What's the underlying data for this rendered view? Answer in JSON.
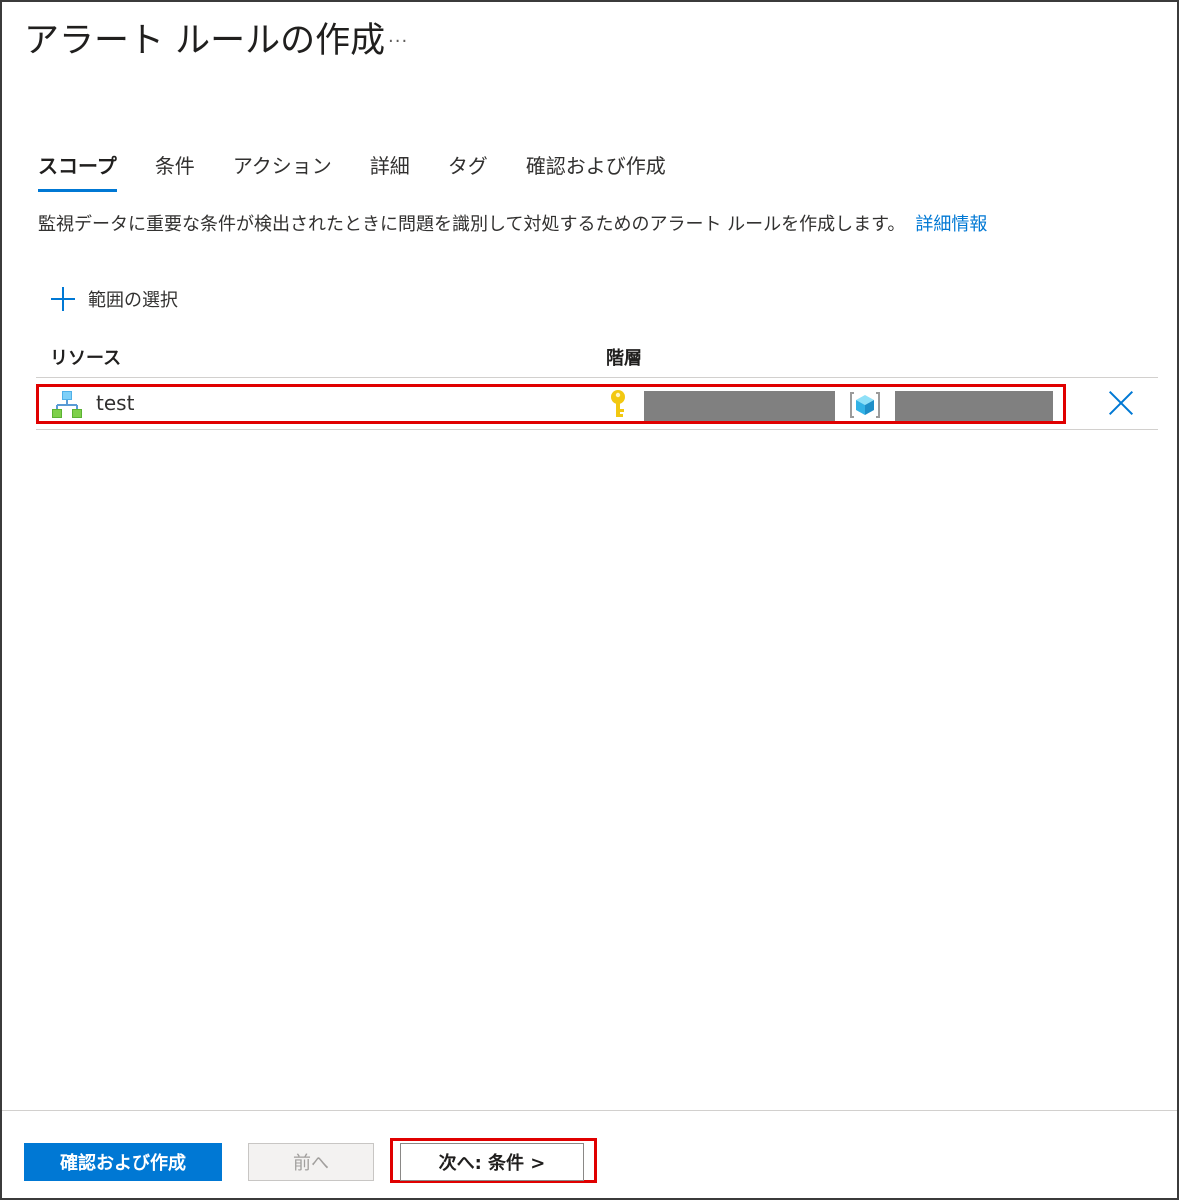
{
  "header": {
    "title": "アラート ルールの作成",
    "more_label": "..."
  },
  "tabs": [
    {
      "label": "スコープ",
      "active": true
    },
    {
      "label": "条件",
      "active": false
    },
    {
      "label": "アクション",
      "active": false
    },
    {
      "label": "詳細",
      "active": false
    },
    {
      "label": "タグ",
      "active": false
    },
    {
      "label": "確認および作成",
      "active": false
    }
  ],
  "description": {
    "text": "監視データに重要な条件が検出されたときに問題を識別して対処するためのアラート ルールを作成します。",
    "link_label": "詳細情報"
  },
  "scope": {
    "add_label": "範囲の選択",
    "columns": {
      "resource": "リソース",
      "hierarchy": "階層"
    },
    "rows": [
      {
        "resource_name": "test",
        "resource_icon": "resource-group-icon",
        "hierarchy_icons": [
          "key-icon",
          "cube-icon"
        ]
      }
    ]
  },
  "footer": {
    "review_create_label": "確認および作成",
    "previous_label": "前へ",
    "next_label": "次へ: 条件 >"
  },
  "colors": {
    "accent": "#0078d4",
    "highlight": "#e00000",
    "redacted": "#808080"
  }
}
